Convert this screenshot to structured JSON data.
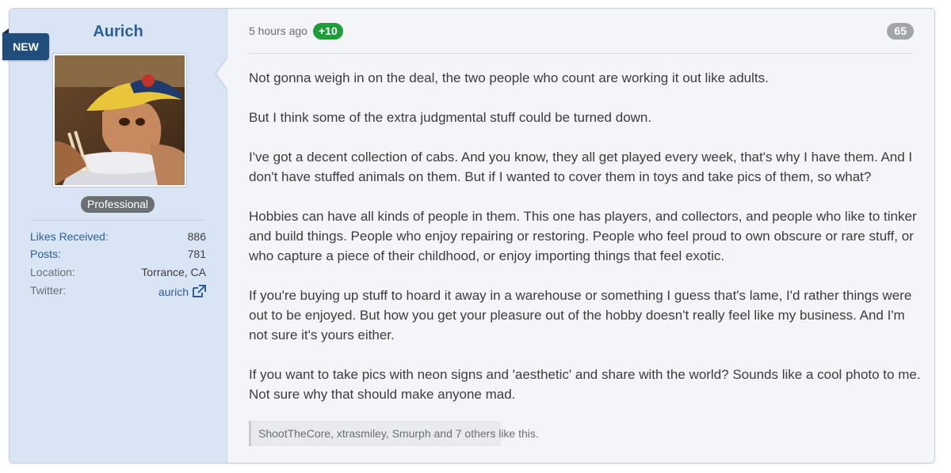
{
  "user": {
    "name": "Aurich",
    "new_badge": "NEW",
    "title": "Professional",
    "stats": [
      {
        "label": "Likes Received:",
        "value": "886"
      },
      {
        "label": "Posts:",
        "value": "781"
      },
      {
        "label": "Location:",
        "value": "Torrance, CA"
      },
      {
        "label": "Twitter:",
        "value": "aurich"
      }
    ]
  },
  "post": {
    "timestamp": "5 hours ago",
    "rating": "+10",
    "number": "65",
    "paragraphs": [
      "Not gonna weigh in on the deal, the two people who count are working it out like adults.",
      "But I think some of the extra judgmental stuff could be turned down.",
      "I've got a decent collection of cabs. And you know, they all get played every week, that's why I have them. And I don't have stuffed animals on them. But if I wanted to cover them in toys and take pics of them, so what?",
      "Hobbies can have all kinds of people in them. This one has players, and collectors, and people who like to tinker and build things. People who enjoy repairing or restoring. People who feel proud to own obscure or rare stuff, or who capture a piece of their childhood, or enjoy importing things that feel exotic.",
      "If you're buying up stuff to hoard it away in a warehouse or something I guess that's lame, I'd rather things were out to be enjoyed. But how you get your pleasure out of the hobby doesn't really feel like my business. And I'm not sure it's yours either.",
      "If you want to take pics with neon signs and 'aesthetic' and share with the world? Sounds like a cool photo to me. Not sure why that should make anyone mad."
    ],
    "likes_summary": "ShootTheCore, xtrasmiley, Smurph and 7 others like this."
  },
  "icons": {
    "external_link": "external-link-icon"
  },
  "colors": {
    "sidebar_bg": "#d9e5f4",
    "username": "#2c5f94",
    "rating_green": "#1f9d3a",
    "new_ribbon": "#214d7c"
  }
}
